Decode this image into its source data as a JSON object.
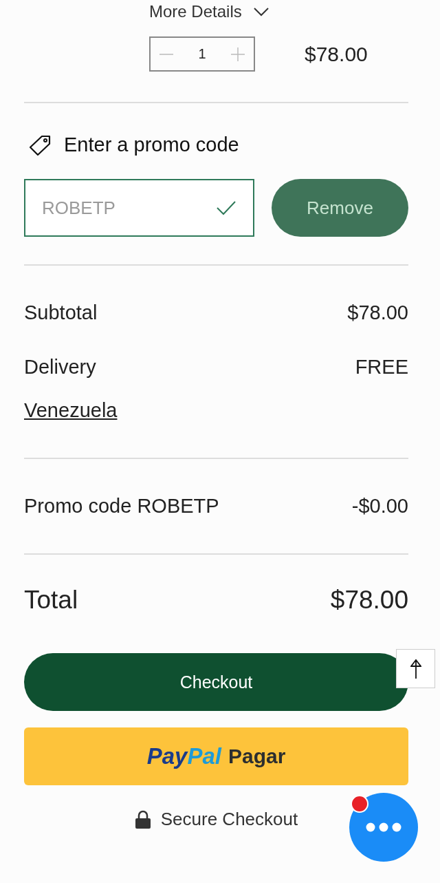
{
  "item": {
    "details_label": "More Details",
    "expanded": false,
    "quantity": "1",
    "decrease_disabled": true,
    "price": "$78.00"
  },
  "promo": {
    "label": "Enter a promo code",
    "value": "ROBETP",
    "valid": true,
    "button": "Remove"
  },
  "summary": [
    {
      "label": "Subtotal",
      "value": "$78.00"
    },
    {
      "label": "Delivery",
      "value": "FREE",
      "link": "Venezuela"
    }
  ],
  "discount": {
    "label": "Promo code ROBETP",
    "value": "-$0.00"
  },
  "total": {
    "label": "Total",
    "value": "$78.00"
  },
  "checkout_button": "Checkout",
  "paypal_button": {
    "logo": [
      "Pay",
      "Pal"
    ],
    "label": "Pagar"
  },
  "secure_note": "Secure Checkout",
  "chat": {
    "unread": true
  }
}
